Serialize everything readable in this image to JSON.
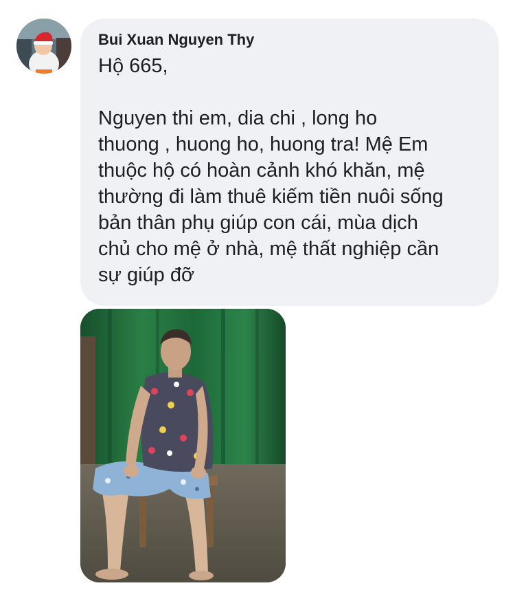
{
  "comment": {
    "author": "Bui Xuan Nguyen Thy",
    "lines": [
      "Hộ 665,",
      "Nguyen  thi em,  dia chi , long  ho",
      "thuong , huong ho,  huong tra! Mệ Em",
      "thuộc hộ có hoàn cảnh khó khăn, mệ",
      "thường đi làm thuê kiếm tiền nuôi sống",
      "bản thân phụ giúp con cái, mùa dịch",
      "chủ cho mệ ở nhà, mệ thất nghiệp cần",
      "sự giúp đỡ"
    ]
  },
  "colors": {
    "bubble": "#f0f1f4",
    "text": "#1c1e21",
    "curtain": "#1f6a3a"
  },
  "icons": {
    "avatar": "profile-photo-child"
  }
}
